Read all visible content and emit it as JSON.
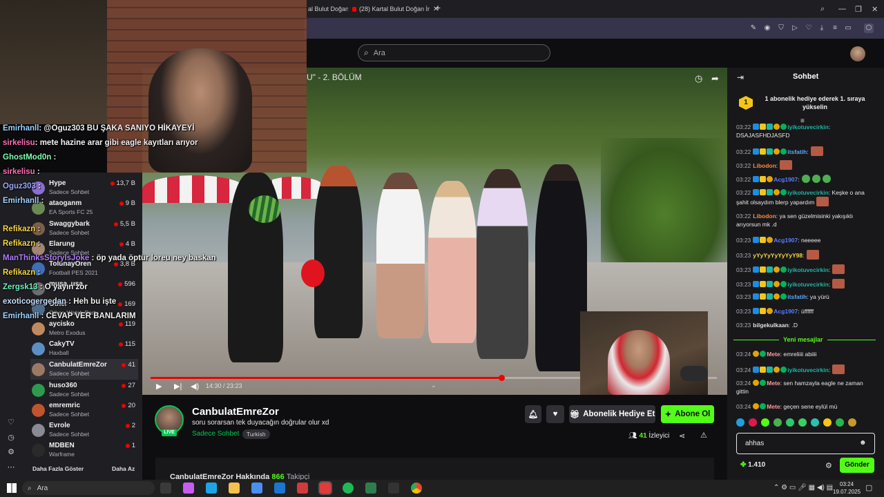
{
  "tabs": [
    {
      "label": "al Bulut Doğan ç"
    },
    {
      "label": "(28) Kartal Bulut Doğan İr"
    }
  ],
  "search": {
    "placeholder": "Ara"
  },
  "video": {
    "title": "U\" - 2. BÖLÜM",
    "time": "14:30 / 23:23",
    "progress": 0.62
  },
  "overlay_chat": [
    {
      "user": "Emirhanll",
      "text": ": @Oguz303 BU ŞAKA SANIYO HİKAYEYİ",
      "color": "#9fd2ff"
    },
    {
      "user": "sirkelisu",
      "text": ": mete hazine arar gibi eagle kayıtları arıyor",
      "color": "#ff6fb5"
    },
    {
      "user": "GhostMod0n",
      "text": " :",
      "color": "#7dffb0"
    },
    {
      "user": "sirkelisu",
      "text": " :",
      "color": "#ff6fb5"
    },
    {
      "user": "Oguz303",
      "text": " :",
      "color": "#9aa8ff"
    },
    {
      "user": "Emirhanll",
      "text": " :",
      "color": "#9fd2ff"
    },
    {
      "user": "Refikazn",
      "text": " :",
      "color": "#f5d742"
    },
    {
      "user": "Refikazn",
      "text": " :",
      "color": "#f5d742"
    },
    {
      "user": "ManThinksStoryIsJoke",
      "text": " : öp yada öptür loreu ney baskan",
      "color": "#b07cff"
    },
    {
      "user": "Refikazn",
      "text": " :",
      "color": "#f5d742"
    },
    {
      "user": "Zergsk13",
      "text": " : O yayın zor",
      "color": "#6ff0c0"
    },
    {
      "user": "exoticogergedan",
      "text": " : Heh bu işte",
      "color": "#c8e0ff"
    },
    {
      "user": "Emirhanll",
      "text": " : CEVAP VER BANLARIM",
      "color": "#9fd2ff"
    }
  ],
  "sidebar": {
    "channels": [
      {
        "name": "Hype",
        "game": "Sadece Sohbet",
        "viewers": "13,7 B",
        "color": "#8a6fd1"
      },
      {
        "name": "ataoganm",
        "game": "EA Sports FC 25",
        "viewers": "9 B",
        "color": "#6b8a52"
      },
      {
        "name": "Swaggybark",
        "game": "Sadece Sohbet",
        "viewers": "5,5 B",
        "color": "#7c5f4b"
      },
      {
        "name": "Elarung",
        "game": "Sadece Sohbet",
        "viewers": "4 B",
        "color": "#a38672"
      },
      {
        "name": "TolunayOren",
        "game": "Football PES 2021",
        "viewers": "3,8 B",
        "color": "#3f6fb4"
      },
      {
        "name": "musa_usa",
        "game": "",
        "viewers": "596",
        "color": "#6d6d6d"
      },
      {
        "name": "Other",
        "game": "Other, Watch Party",
        "viewers": "169",
        "color": "#4f6d8a"
      },
      {
        "name": "aycisko",
        "game": "Metro Exodus",
        "viewers": "119",
        "color": "#c0895e"
      },
      {
        "name": "CakyTV",
        "game": "Haxball",
        "viewers": "115",
        "color": "#5b8fc4"
      },
      {
        "name": "CanbulatEmreZor",
        "game": "Sadece Sohbet",
        "viewers": "41",
        "color": "#9b7a64"
      },
      {
        "name": "huso360",
        "game": "Sadece Sohbet",
        "viewers": "27",
        "color": "#2e9a4e"
      },
      {
        "name": "emremric",
        "game": "Sadece Sohbet",
        "viewers": "20",
        "color": "#c2542d"
      },
      {
        "name": "Evrole",
        "game": "Sadece Sohbet",
        "viewers": "2",
        "color": "#8a8a95"
      },
      {
        "name": "MDBEN",
        "game": "Warframe",
        "viewers": "1",
        "color": "#2a2a2a"
      }
    ],
    "show_more": "Daha Fazla Göster",
    "show_less": "Daha Az"
  },
  "channel": {
    "name": "CanbulatEmreZor",
    "title": "soru sorarsan tek duyacağın doğrular olur xd",
    "category": "Sadece Sohbet",
    "tag": "Turkish",
    "live": "LIVE",
    "gift_label": "Abonelik Hediye Et",
    "sub_label": "Abone Ol",
    "viewers": "41",
    "viewers_label": "İzleyici",
    "about": "CanbulatEmreZor Hakkında",
    "followers": "866",
    "followers_label": "Takipçi"
  },
  "chat": {
    "header": "Sohbet",
    "promo": "1 abonelik hediye ederek 1. sıraya yükselin",
    "promo_rank": "1",
    "new_messages": "Yeni mesajlar",
    "input_value": "ahhas",
    "points": "1.410",
    "send": "Gönder",
    "messages": [
      {
        "time": "03:22",
        "user": "iyikotuvecirkin",
        "text": ": DSAJASFHDJASFD",
        "color": "#1fb5a5"
      },
      {
        "time": "03:22",
        "user": "itsfatih",
        "text": ":",
        "color": "#5aa9ff"
      },
      {
        "time": "03:22",
        "user": "Libodon",
        "text": ":",
        "color": "#ff8a3d"
      },
      {
        "time": "03:22",
        "user": "Acg1907",
        "text": ":",
        "color": "#5a7dff"
      },
      {
        "time": "03:22",
        "user": "iyikotuvecirkin",
        "text": ": Keşke o ana şahit olsaydım blerp yapardım",
        "color": "#1fb5a5"
      },
      {
        "time": "03:22",
        "user": "Libodon",
        "text": ": ya sen güzelmisinki yakışıklı arıyorsun mk .d",
        "color": "#ff8a3d"
      },
      {
        "time": "03:23",
        "user": "Acg1907",
        "text": ": neeeee",
        "color": "#5a7dff"
      },
      {
        "time": "03:23",
        "user": "yYyYyYyYyYyY98",
        "text": ":",
        "color": "#f5d742"
      },
      {
        "time": "03:23",
        "user": "iyikotuvecirkin",
        "text": ":",
        "color": "#1fb5a5"
      },
      {
        "time": "03:23",
        "user": "iyikotuvecirkin",
        "text": ":",
        "color": "#1fb5a5"
      },
      {
        "time": "03:23",
        "user": "itsfatih",
        "text": ": ya yürü",
        "color": "#5aa9ff"
      },
      {
        "time": "03:23",
        "user": "Acg1907",
        "text": ": üffffff",
        "color": "#5a7dff"
      },
      {
        "time": "03:23",
        "user": "bilgekulkaan",
        "text": ": .D",
        "color": "#e0e0e0"
      },
      {
        "time": "03:24",
        "user": "Mete",
        "text": ": emreliiii abiiii",
        "color": "#ff9a9a"
      },
      {
        "time": "03:24",
        "user": "iyikotuvecirkin",
        "text": ":",
        "color": "#1fb5a5"
      },
      {
        "time": "03:24",
        "user": "Mete",
        "text": ": sen hamzayla eagle ne zaman gittin",
        "color": "#ff9a9a"
      },
      {
        "time": "03:24",
        "user": "Mete",
        "text": ": geçen sene eylül mü",
        "color": "#ff9a9a"
      }
    ]
  },
  "taskbar": {
    "search": "Ara",
    "time": "03:24",
    "date": "19.07.2025"
  }
}
